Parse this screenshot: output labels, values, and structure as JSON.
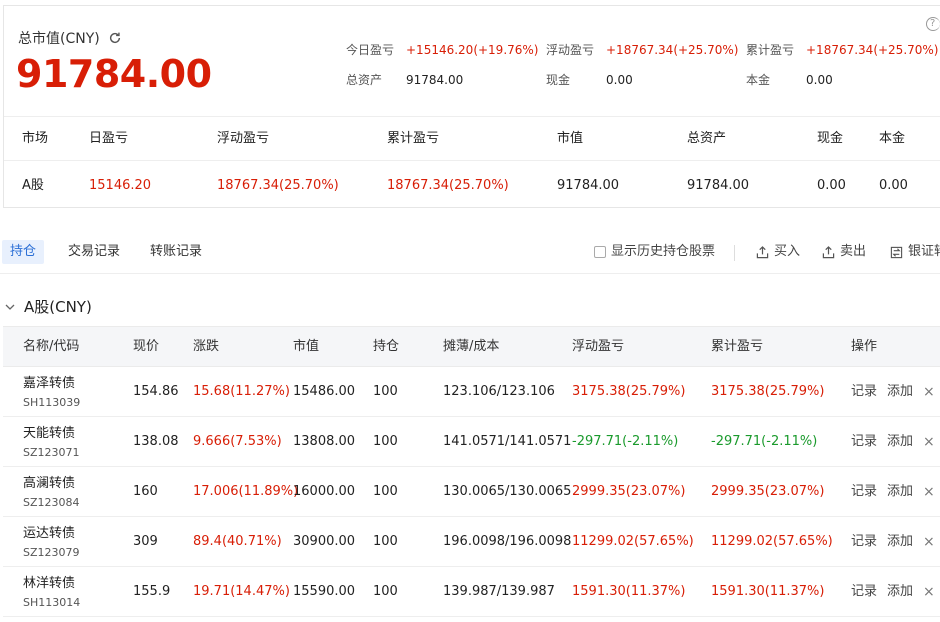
{
  "summary": {
    "title": "总市值(CNY)",
    "total_value": "91784.00",
    "help_label": "?",
    "metrics": [
      {
        "label": "今日盈亏",
        "value": "+15146.20(+19.76%)",
        "color": "red"
      },
      {
        "label": "浮动盈亏",
        "value": "+18767.34(+25.70%)",
        "color": "red"
      },
      {
        "label": "累计盈亏",
        "value": "+18767.34(+25.70%)",
        "color": "red"
      },
      {
        "label": "总资产",
        "value": "91784.00",
        "color": "dark"
      },
      {
        "label": "现金",
        "value": "0.00",
        "color": "dark"
      },
      {
        "label": "本金",
        "value": "0.00",
        "color": "dark"
      }
    ],
    "market_table": {
      "headers": [
        "市场",
        "日盈亏",
        "浮动盈亏",
        "累计盈亏",
        "市值",
        "总资产",
        "现金",
        "本金"
      ],
      "row": [
        "A股",
        "15146.20",
        "18767.34(25.70%)",
        "18767.34(25.70%)",
        "91784.00",
        "91784.00",
        "0.00",
        "0.00"
      ]
    }
  },
  "tabs": {
    "items": [
      "持仓",
      "交易记录",
      "转账记录"
    ],
    "active": "持仓",
    "show_history_label": "显示历史持仓股票",
    "buy_label": "买入",
    "sell_label": "卖出",
    "bank_label": "银证转"
  },
  "section": {
    "title": "A股(CNY)"
  },
  "holdings": {
    "headers": [
      "名称/代码",
      "现价",
      "涨跌",
      "市值",
      "持仓",
      "摊薄/成本",
      "浮动盈亏",
      "累计盈亏",
      "操作"
    ],
    "record_label": "记录",
    "add_label": "添加",
    "remove_label": "×",
    "rows": [
      {
        "name": "嘉泽转债",
        "code": "SH113039",
        "price": "154.86",
        "change": "15.68(11.27%)",
        "change_color": "red",
        "market_value": "15486.00",
        "position": "100",
        "cost": "123.106/123.106",
        "float_pl": "3175.38(25.79%)",
        "float_color": "red",
        "total_pl": "3175.38(25.79%)",
        "total_color": "red"
      },
      {
        "name": "天能转债",
        "code": "SZ123071",
        "price": "138.08",
        "change": "9.666(7.53%)",
        "change_color": "red",
        "market_value": "13808.00",
        "position": "100",
        "cost": "141.0571/141.0571",
        "float_pl": "-297.71(-2.11%)",
        "float_color": "green",
        "total_pl": "-297.71(-2.11%)",
        "total_color": "green"
      },
      {
        "name": "高澜转债",
        "code": "SZ123084",
        "price": "160",
        "change": "17.006(11.89%)",
        "change_color": "red",
        "market_value": "16000.00",
        "position": "100",
        "cost": "130.0065/130.0065",
        "float_pl": "2999.35(23.07%)",
        "float_color": "red",
        "total_pl": "2999.35(23.07%)",
        "total_color": "red"
      },
      {
        "name": "运达转债",
        "code": "SZ123079",
        "price": "309",
        "change": "89.4(40.71%)",
        "change_color": "red",
        "market_value": "30900.00",
        "position": "100",
        "cost": "196.0098/196.0098",
        "float_pl": "11299.02(57.65%)",
        "float_color": "red",
        "total_pl": "11299.02(57.65%)",
        "total_color": "red"
      },
      {
        "name": "林洋转债",
        "code": "SH113014",
        "price": "155.9",
        "change": "19.71(14.47%)",
        "change_color": "red",
        "market_value": "15590.00",
        "position": "100",
        "cost": "139.987/139.987",
        "float_pl": "1591.30(11.37%)",
        "float_color": "red",
        "total_pl": "1591.30(11.37%)",
        "total_color": "red"
      }
    ]
  },
  "colors": {
    "red": "#d81e06",
    "green": "#1a9a2c",
    "accent": "#2b6fd6"
  }
}
